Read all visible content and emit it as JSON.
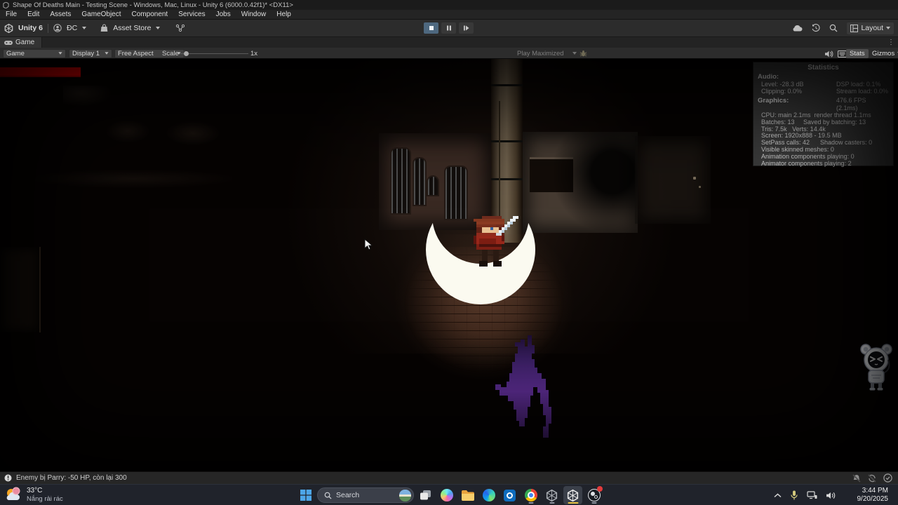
{
  "window": {
    "title": "Shape Of Deaths Main - Testing Scene - Windows, Mac, Linux - Unity 6 (6000.0.42f1)* <DX11>",
    "menu_items": [
      "File",
      "Edit",
      "Assets",
      "GameObject",
      "Component",
      "Services",
      "Jobs",
      "Window",
      "Help"
    ]
  },
  "toolbar": {
    "product": "Unity 6",
    "account": "ĐC",
    "asset_store": "Asset Store",
    "layout": "Layout"
  },
  "game_tab": {
    "label": "Game"
  },
  "view_toolbar": {
    "mode": "Game",
    "display": "Display 1",
    "aspect": "Free Aspect",
    "scale_label": "Scale",
    "scale_value": "1x",
    "play_maximized": "Play Maximized",
    "stats_label": "Stats",
    "gizmos_label": "Gizmos"
  },
  "stats_panel": {
    "title": "Statistics",
    "audio_header": "Audio:",
    "audio_rows": [
      {
        "l": "Level: -28.3 dB",
        "r": "DSP load: 0.1%"
      },
      {
        "l": "Clipping: 0.0%",
        "r": "Stream load: 0.0%"
      }
    ],
    "graphics_header": "Graphics:",
    "fps": "476.6 FPS (2.1ms)",
    "lines": [
      "CPU: main 2.1ms  render thread 1.1ms",
      "Batches: 13     Saved by batching: 13",
      "Tris: 7.5k   Verts: 14.4k",
      "Screen: 1920x888 - 19.5 MB",
      "SetPass calls: 42      Shadow casters: 0",
      "Visible skinned meshes: 0",
      "Animation components playing: 0",
      "Animator components playing: 2"
    ]
  },
  "status_bar": {
    "message": "Enemy bị Parry: -50 HP, còn lại 300"
  },
  "taskbar": {
    "weather_temp": "33°C",
    "weather_desc": "Nắng rải rác",
    "search_label": "Search",
    "clock_time": "3:44 PM",
    "clock_date": "9/20/2025"
  },
  "colors": {
    "health_bar": "#ff0000",
    "play_active": "#4e687f",
    "creature_purple": "#5c2d91",
    "slash_white": "#fbfaf0",
    "taskbar_active_underline": "#e8c341"
  }
}
